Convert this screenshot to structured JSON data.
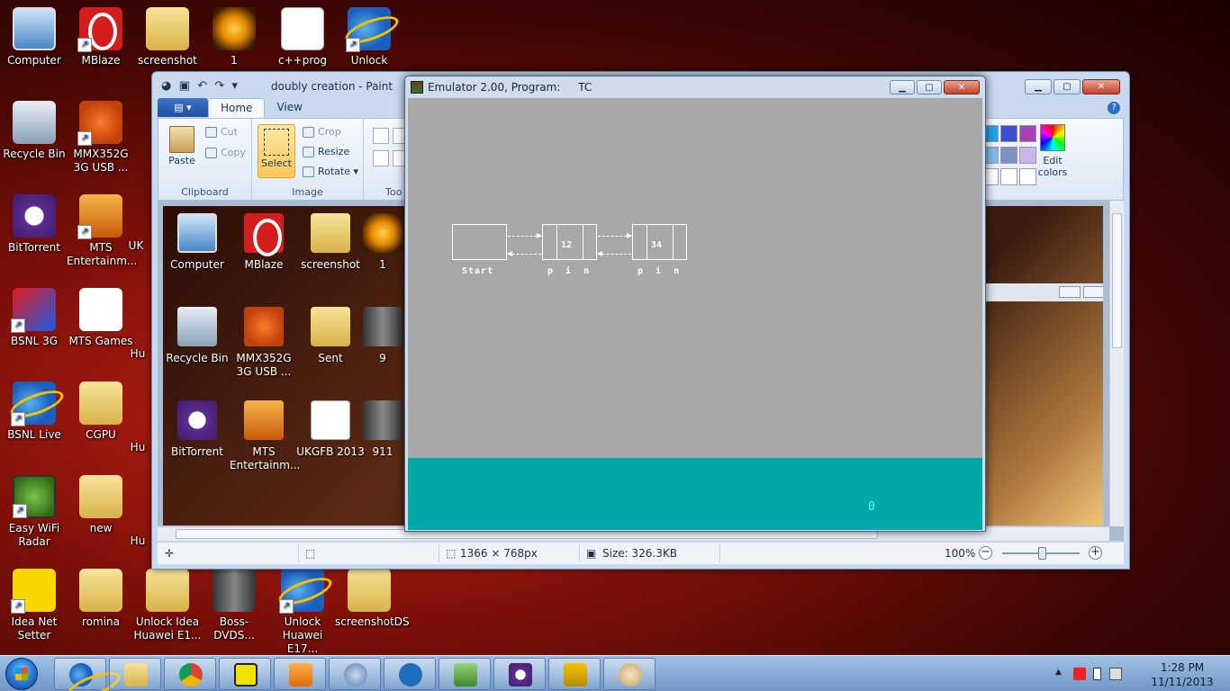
{
  "desktop": {
    "icons": [
      {
        "label": "Computer"
      },
      {
        "label": "MBlaze"
      },
      {
        "label": "screenshot"
      },
      {
        "label": "1"
      },
      {
        "label": "c++prog"
      },
      {
        "label": "Unlock"
      },
      {
        "label": "Recycle Bin"
      },
      {
        "label": "MMX352G 3G USB ..."
      },
      {
        "label": "BitTorrent"
      },
      {
        "label": "MTS Entertainm..."
      },
      {
        "label": "BSNL 3G"
      },
      {
        "label": "MTS Games"
      },
      {
        "label": "BSNL Live"
      },
      {
        "label": "CGPU"
      },
      {
        "label": "Easy WiFi Radar"
      },
      {
        "label": "new"
      },
      {
        "label": "Idea Net Setter"
      },
      {
        "label": "romina"
      },
      {
        "label": "Unlock Idea Huawei E1..."
      },
      {
        "label": "Boss-DVDS..."
      },
      {
        "label": "Unlock Huawei E17..."
      },
      {
        "label": "screenshotDS"
      }
    ],
    "partial_labels": {
      "uk": "UK",
      "hu": "Hu"
    }
  },
  "paint": {
    "title": "doubly creation - Paint",
    "tabs": {
      "file": "▤ ▾",
      "home": "Home",
      "view": "View"
    },
    "clipboard": {
      "paste": "Paste",
      "cut": "Cut",
      "copy": "Copy",
      "group": "Clipboard"
    },
    "image": {
      "select": "Select",
      "crop": "Crop",
      "resize": "Resize",
      "rotate": "Rotate ▾",
      "group": "Image"
    },
    "tools_group": "Too",
    "edit_colors": "Edit colors",
    "palette_colors": [
      "#1fa2e8",
      "#3b4fd0",
      "#a442b6",
      "#7fb8e8",
      "#7d92c6",
      "#c8b6e6",
      "#ffffff",
      "#ffffff",
      "#ffffff"
    ],
    "canvas_icons": [
      {
        "label": "Computer"
      },
      {
        "label": "MBlaze"
      },
      {
        "label": "screenshot"
      },
      {
        "label": "1"
      },
      {
        "label": "Recycle Bin"
      },
      {
        "label": "MMX352G 3G USB ..."
      },
      {
        "label": "Sent"
      },
      {
        "label": "9"
      },
      {
        "label": "BitTorrent"
      },
      {
        "label": "MTS Entertainm..."
      },
      {
        "label": "UKGFB 2013"
      },
      {
        "label": "911"
      }
    ],
    "status": {
      "dimensions": "1366 × 768px",
      "size": "Size: 326.3KB",
      "zoom": "100%"
    }
  },
  "emulator": {
    "title": "Emulator 2.00, Program:",
    "program": "TC",
    "nodes": [
      {
        "value": "",
        "label": "Start"
      },
      {
        "value": "12",
        "label": "p  i  n"
      },
      {
        "value": "34",
        "label": "p  i  n"
      }
    ],
    "status_value": "0"
  },
  "taskbar": {
    "time": "1:28 PM",
    "date": "11/11/2013",
    "apps": [
      "internet-explorer",
      "windows-explorer",
      "chrome",
      "turbo-c",
      "media-player",
      "mascot",
      "hp",
      "installer",
      "bittorrent",
      "video-player",
      "paint"
    ]
  }
}
